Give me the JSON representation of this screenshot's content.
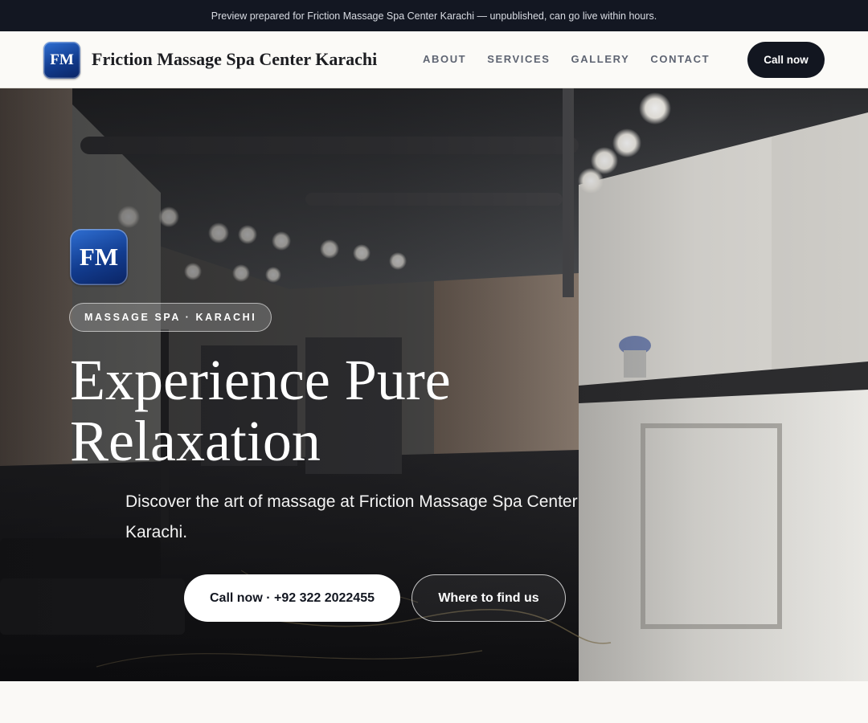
{
  "preview_bar": {
    "text": "Preview prepared for Friction Massage Spa Center Karachi — unpublished, can go live within hours."
  },
  "header": {
    "logo_text": "FM",
    "brand_name": "Friction Massage Spa Center Karachi",
    "nav": [
      "ABOUT",
      "SERVICES",
      "GALLERY",
      "CONTACT"
    ],
    "call_label": "Call now"
  },
  "hero": {
    "logo_text": "FM",
    "tag": "MASSAGE SPA · KARACHI",
    "title": "Experience Pure Relaxation",
    "subtitle": "Discover the art of massage at Friction Massage Spa Center Karachi.",
    "primary_button": "Call now · +92 322 2022455",
    "secondary_button": "Where to find us",
    "background": "spa-interior-photo"
  },
  "colors": {
    "dark": "#121620",
    "preview_bar_bg": "#131722",
    "page_bg": "#faf9f6",
    "logo_blue": "#123c8f",
    "nav_text": "#5e6472"
  }
}
